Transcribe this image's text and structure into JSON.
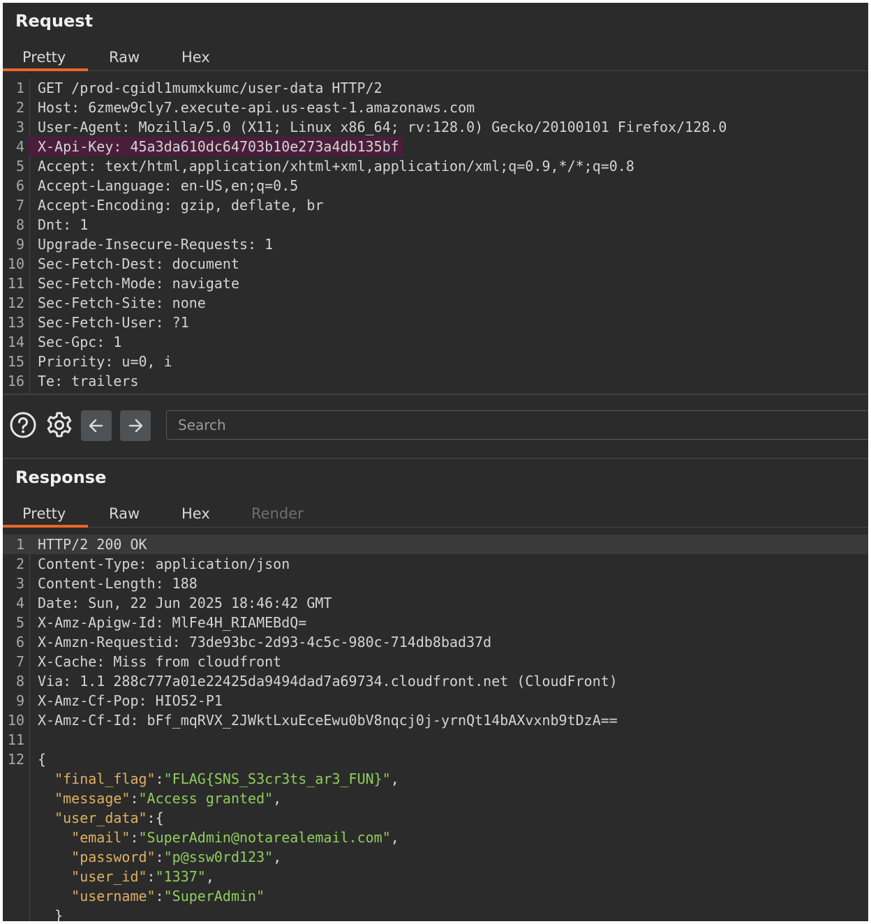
{
  "request": {
    "title": "Request",
    "tabs": [
      "Pretty",
      "Raw",
      "Hex"
    ],
    "lines": [
      {
        "n": "1",
        "k": "GET /prod-cgidl1mumxkumc/user-data HTTP/2",
        "v": ""
      },
      {
        "n": "2",
        "k": "Host",
        "v": " 6zmew9cly7.execute-api.us-east-1.amazonaws.com"
      },
      {
        "n": "3",
        "k": "User-Agent",
        "v": " Mozilla/5.0 (X11; Linux x86_64; rv:128.0) Gecko/20100101 Firefox/128.0"
      },
      {
        "n": "4",
        "k": "X-Api-Key",
        "v": " 45a3da610dc64703b10e273a4db135bf"
      },
      {
        "n": "5",
        "k": "Accept",
        "v": " text/html,application/xhtml+xml,application/xml;q=0.9,*/*;q=0.8"
      },
      {
        "n": "6",
        "k": "Accept-Language",
        "v": " en-US,en;q=0.5"
      },
      {
        "n": "7",
        "k": "Accept-Encoding",
        "v": " gzip, deflate, br"
      },
      {
        "n": "8",
        "k": "Dnt",
        "v": " 1"
      },
      {
        "n": "9",
        "k": "Upgrade-Insecure-Requests",
        "v": " 1"
      },
      {
        "n": "10",
        "k": "Sec-Fetch-Dest",
        "v": " document"
      },
      {
        "n": "11",
        "k": "Sec-Fetch-Mode",
        "v": " navigate"
      },
      {
        "n": "12",
        "k": "Sec-Fetch-Site",
        "v": " none"
      },
      {
        "n": "13",
        "k": "Sec-Fetch-User",
        "v": " ?1"
      },
      {
        "n": "14",
        "k": "Sec-Gpc",
        "v": " 1"
      },
      {
        "n": "15",
        "k": "Priority",
        "v": " u=0, i"
      },
      {
        "n": "16",
        "k": "Te",
        "v": " trailers"
      }
    ]
  },
  "toolbar": {
    "search_placeholder": "Search",
    "help_icon": "help-circle-icon",
    "settings_icon": "gear-icon",
    "back_icon": "arrow-left-icon",
    "forward_icon": "arrow-right-icon"
  },
  "response": {
    "title": "Response",
    "tabs": [
      "Pretty",
      "Raw",
      "Hex",
      "Render"
    ],
    "lines": [
      {
        "n": "1",
        "k": "HTTP/2 200 OK",
        "v": ""
      },
      {
        "n": "2",
        "k": "Content-Type",
        "v": " application/json"
      },
      {
        "n": "3",
        "k": "Content-Length",
        "v": " 188"
      },
      {
        "n": "4",
        "k": "Date",
        "v": " Sun, 22 Jun 2025 18:46:42 GMT"
      },
      {
        "n": "5",
        "k": "X-Amz-Apigw-Id",
        "v": " MlFe4H_RIAMEBdQ="
      },
      {
        "n": "6",
        "k": "X-Amzn-Requestid",
        "v": " 73de93bc-2d93-4c5c-980c-714db8bad37d"
      },
      {
        "n": "7",
        "k": "X-Cache",
        "v": " Miss from cloudfront"
      },
      {
        "n": "8",
        "k": "Via",
        "v": " 1.1 288c777a01e22425da9494dad7a69734.cloudfront.net (CloudFront)"
      },
      {
        "n": "9",
        "k": "X-Amz-Cf-Pop",
        "v": " HIO52-P1"
      },
      {
        "n": "10",
        "k": "X-Amz-Cf-Id",
        "v": " bFf_mqRVX_2JWktLxuEceEwu0bV8nqcj0j-yrnQt14bAXvxnb9tDzA=="
      },
      {
        "n": "11",
        "k": "",
        "v": ""
      },
      {
        "n": "12",
        "k": "{",
        "v": ""
      }
    ],
    "json": [
      {
        "indent": "  ",
        "key": "\"final_flag\"",
        "val": "\"FLAG{SNS_S3cr3ts_ar3_FUN}\"",
        "tail": ","
      },
      {
        "indent": "  ",
        "key": "\"message\"",
        "val": "\"Access granted\"",
        "tail": ","
      },
      {
        "indent": "  ",
        "key": "\"user_data\"",
        "val": "",
        "tail": "{"
      },
      {
        "indent": "    ",
        "key": "\"email\"",
        "val": "\"SuperAdmin@notarealemail.com\"",
        "tail": ","
      },
      {
        "indent": "    ",
        "key": "\"password\"",
        "val": "\"p@ssw0rd123\"",
        "tail": ","
      },
      {
        "indent": "    ",
        "key": "\"user_id\"",
        "val": "\"1337\"",
        "tail": ","
      },
      {
        "indent": "    ",
        "key": "\"username\"",
        "val": "\"SuperAdmin\"",
        "tail": ""
      },
      {
        "indent": "  ",
        "key": "",
        "val": "",
        "tail": "}"
      }
    ]
  }
}
